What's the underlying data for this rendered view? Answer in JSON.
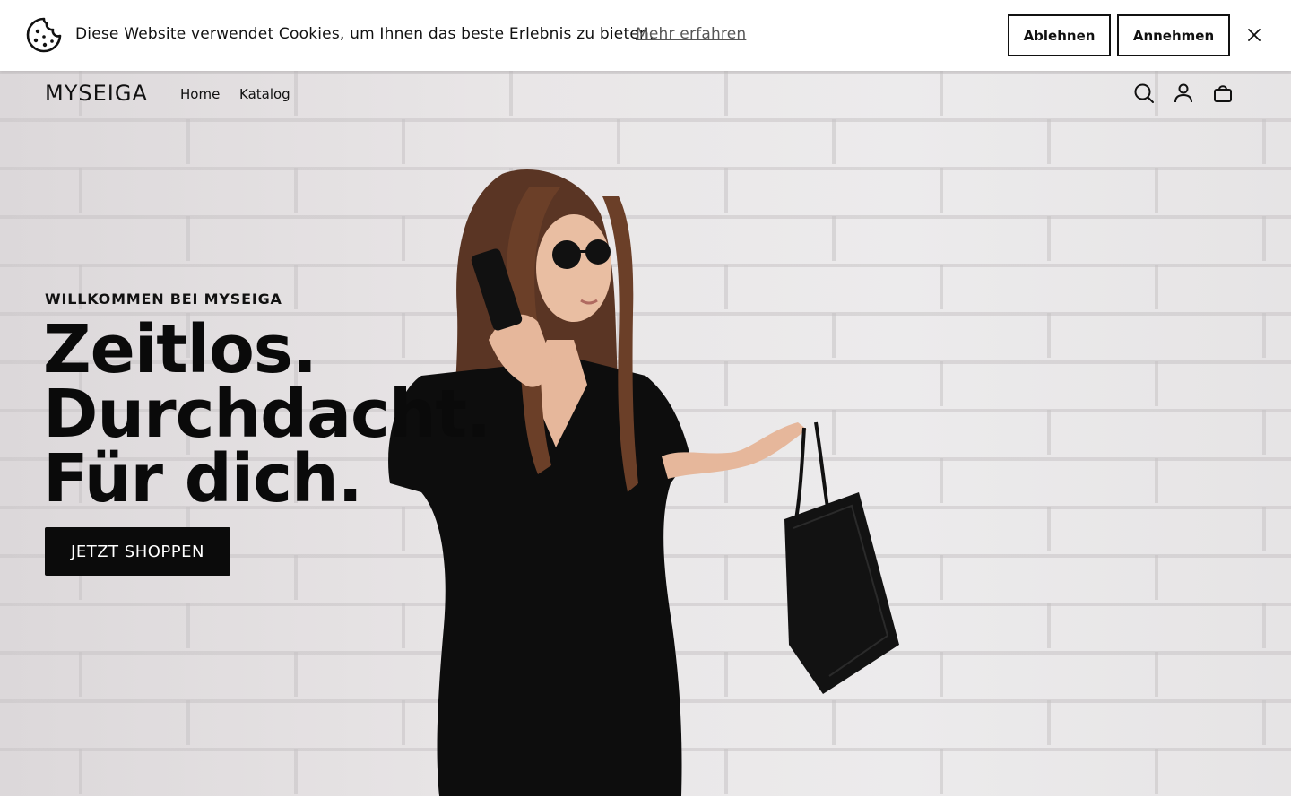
{
  "cookie_banner": {
    "message": "Diese Website verwendet Cookies, um Ihnen das beste Erlebnis zu bieten.",
    "learn_more": "Mehr erfahren",
    "decline_label": "Ablehnen",
    "accept_label": "Annehmen",
    "icons": [
      "cookie-icon",
      "close-icon"
    ]
  },
  "header": {
    "logo": "MYSEIGA",
    "nav": [
      {
        "label": "Home"
      },
      {
        "label": "Katalog"
      }
    ],
    "icons": [
      "search-icon",
      "account-icon",
      "cart-icon"
    ]
  },
  "hero": {
    "eyebrow": "WILLKOMMEN BEI MYSEIGA",
    "headline_lines": [
      "Zeitlos.",
      "Durchdacht.",
      "Für dich."
    ],
    "cta_label": "JETZT SHOPPEN"
  },
  "colors": {
    "primary": "#0b0b0b",
    "background": "#ffffff",
    "hero_wall": "#e4e1e2"
  }
}
